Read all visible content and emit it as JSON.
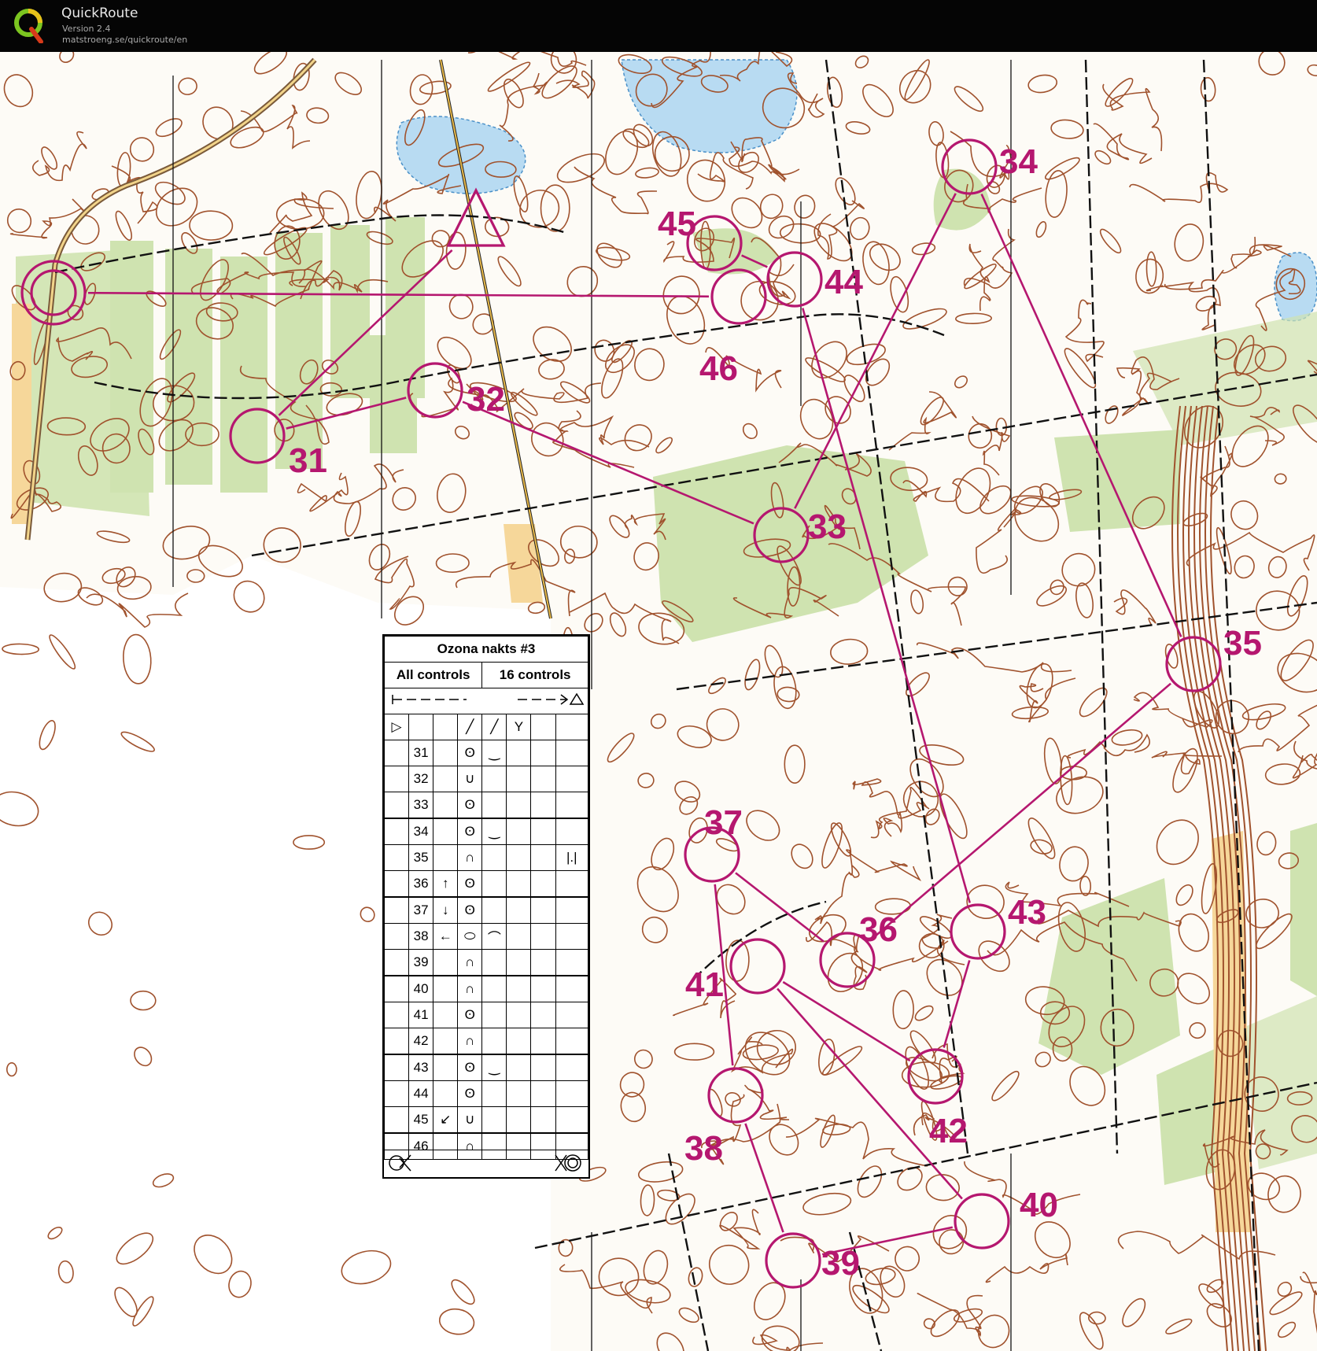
{
  "app": {
    "title": "QuickRoute",
    "version": "Version 2.4",
    "url": "matstroeng.se/quickroute/en"
  },
  "colors": {
    "course": "#b5176f",
    "contour": "#a0522d",
    "vegetation": "#cfe3b0",
    "water": "#9ec9ea",
    "background": "#ffffff"
  },
  "controls": [
    "31",
    "32",
    "33",
    "34",
    "35",
    "36",
    "37",
    "38",
    "39",
    "40",
    "41",
    "42",
    "43",
    "44",
    "45",
    "46"
  ],
  "description": {
    "title": "Ozona nakts #3",
    "course": "All controls",
    "controls_count": "16 controls",
    "rows": [
      {
        "num": "31",
        "dir": "",
        "feature": "ʘ",
        "detail": "‿",
        "extra": ""
      },
      {
        "num": "32",
        "dir": "",
        "feature": "∪",
        "detail": "",
        "extra": ""
      },
      {
        "num": "33",
        "dir": "",
        "feature": "ʘ",
        "detail": "",
        "extra": ""
      },
      {
        "num": "34",
        "dir": "",
        "feature": "ʘ",
        "detail": "‿",
        "extra": ""
      },
      {
        "num": "35",
        "dir": "",
        "feature": "∩",
        "detail": "",
        "extra": "|.|"
      },
      {
        "num": "36",
        "dir": "↑",
        "feature": "ʘ",
        "detail": "",
        "extra": ""
      },
      {
        "num": "37",
        "dir": "↓",
        "feature": "ʘ",
        "detail": "",
        "extra": ""
      },
      {
        "num": "38",
        "dir": "←",
        "feature": "⬭",
        "detail": "⌒",
        "extra": ""
      },
      {
        "num": "39",
        "dir": "",
        "feature": "∩",
        "detail": "",
        "extra": ""
      },
      {
        "num": "40",
        "dir": "",
        "feature": "∩",
        "detail": "",
        "extra": ""
      },
      {
        "num": "41",
        "dir": "",
        "feature": "ʘ",
        "detail": "",
        "extra": ""
      },
      {
        "num": "42",
        "dir": "",
        "feature": "∩",
        "detail": "",
        "extra": ""
      },
      {
        "num": "43",
        "dir": "",
        "feature": "ʘ",
        "detail": "‿",
        "extra": ""
      },
      {
        "num": "44",
        "dir": "",
        "feature": "ʘ",
        "detail": "",
        "extra": ""
      },
      {
        "num": "45",
        "dir": "↙",
        "feature": "∪",
        "detail": "",
        "extra": ""
      },
      {
        "num": "46",
        "dir": "",
        "feature": "∩",
        "detail": "",
        "extra": ""
      }
    ]
  }
}
